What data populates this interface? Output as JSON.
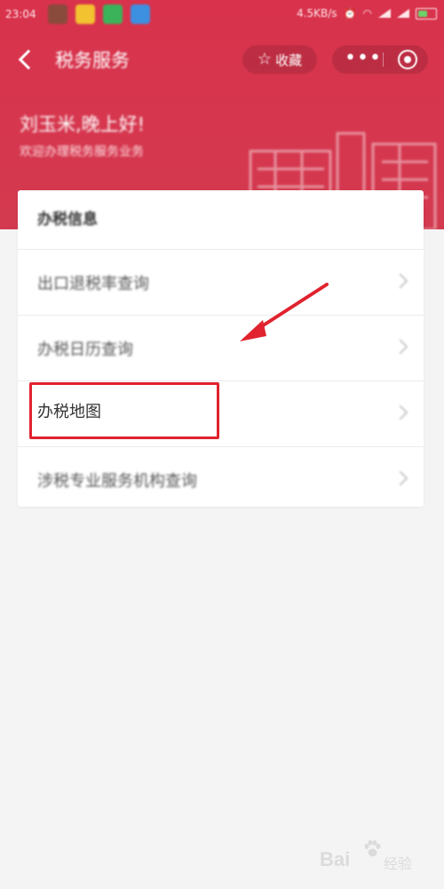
{
  "status_bar": {
    "time": "23:04",
    "speed": "4.5KB/s",
    "app_icons": [
      "avatar-app-icon",
      "yellow-app-icon",
      "green-app-icon",
      "blue-app-icon"
    ],
    "app_colors": [
      "#8a4a3c",
      "#f2c230",
      "#3bb35a",
      "#3d8fe0"
    ]
  },
  "nav": {
    "title": "税务服务",
    "favorite_label": "收藏",
    "more_label": "•••"
  },
  "hero": {
    "greeting": "刘玉米,晚上好!",
    "subtitle": "欢迎办理税务服务业务"
  },
  "card": {
    "title": "办税信息",
    "items": [
      {
        "label": "出口退税率查询"
      },
      {
        "label": "办税日历查询"
      },
      {
        "label": "办税地图"
      },
      {
        "label": "涉税专业服务机构查询"
      }
    ]
  },
  "watermark": {
    "brand": "Bai",
    "sub": "经验"
  },
  "colors": {
    "hero_red": "#d9324c",
    "highlight_red": "#e0232e"
  }
}
